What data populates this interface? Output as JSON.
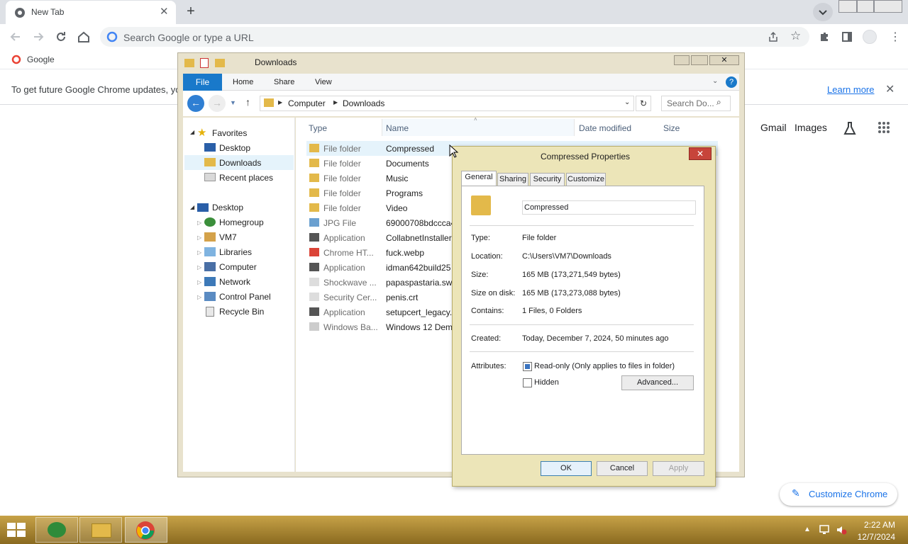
{
  "browser": {
    "tab_title": "New Tab",
    "omnibox_placeholder": "Search Google or type a URL",
    "bookmark": "Google",
    "infobar_text": "To get future Google Chrome updates, yo",
    "learn_more": "Learn more",
    "gmail": "Gmail",
    "images": "Images",
    "customize": "Customize Chrome"
  },
  "explorer": {
    "title": "Downloads",
    "ribbon_tabs": [
      "File",
      "Home",
      "Share",
      "View"
    ],
    "breadcrumb": [
      "Computer",
      "Downloads"
    ],
    "search_placeholder": "Search Do...",
    "nav": {
      "favorites": "Favorites",
      "favorites_items": [
        "Desktop",
        "Downloads",
        "Recent places"
      ],
      "desktop": "Desktop",
      "desktop_items": [
        "Homegroup",
        "VM7",
        "Libraries",
        "Computer",
        "Network",
        "Control Panel",
        "Recycle Bin"
      ]
    },
    "columns": {
      "type": "Type",
      "name": "Name",
      "date": "Date modified",
      "size": "Size"
    },
    "rows": [
      {
        "type": "File folder",
        "name": "Compressed"
      },
      {
        "type": "File folder",
        "name": "Documents"
      },
      {
        "type": "File folder",
        "name": "Music"
      },
      {
        "type": "File folder",
        "name": "Programs"
      },
      {
        "type": "File folder",
        "name": "Video"
      },
      {
        "type": "JPG File",
        "name": "69000708bdccca4"
      },
      {
        "type": "Application",
        "name": "CollabnetInstaller"
      },
      {
        "type": "Chrome HT...",
        "name": "fuck.webp"
      },
      {
        "type": "Application",
        "name": "idman642build25"
      },
      {
        "type": "Shockwave ...",
        "name": "papaspastaria.swf"
      },
      {
        "type": "Security Cer...",
        "name": "penis.crt"
      },
      {
        "type": "Application",
        "name": "setupcert_legacy."
      },
      {
        "type": "Windows Ba...",
        "name": "Windows 12 Dem"
      }
    ]
  },
  "props": {
    "title": "Compressed Properties",
    "tabs": [
      "General",
      "Sharing",
      "Security",
      "Customize"
    ],
    "name_value": "Compressed",
    "fields": [
      {
        "label": "Type:",
        "value": "File folder"
      },
      {
        "label": "Location:",
        "value": "C:\\Users\\VM7\\Downloads"
      },
      {
        "label": "Size:",
        "value": "165 MB (173,271,549 bytes)"
      },
      {
        "label": "Size on disk:",
        "value": "165 MB (173,273,088 bytes)"
      },
      {
        "label": "Contains:",
        "value": "1 Files, 0 Folders"
      }
    ],
    "created_label": "Created:",
    "created_value": "Today, December 7, 2024, 50 minutes ago",
    "attributes_label": "Attributes:",
    "readonly_label": "Read-only (Only applies to files in folder)",
    "hidden_label": "Hidden",
    "advanced_button": "Advanced...",
    "ok_button": "OK",
    "cancel_button": "Cancel",
    "apply_button": "Apply"
  },
  "taskbar": {
    "time": "2:22 AM",
    "date": "12/7/2024"
  }
}
